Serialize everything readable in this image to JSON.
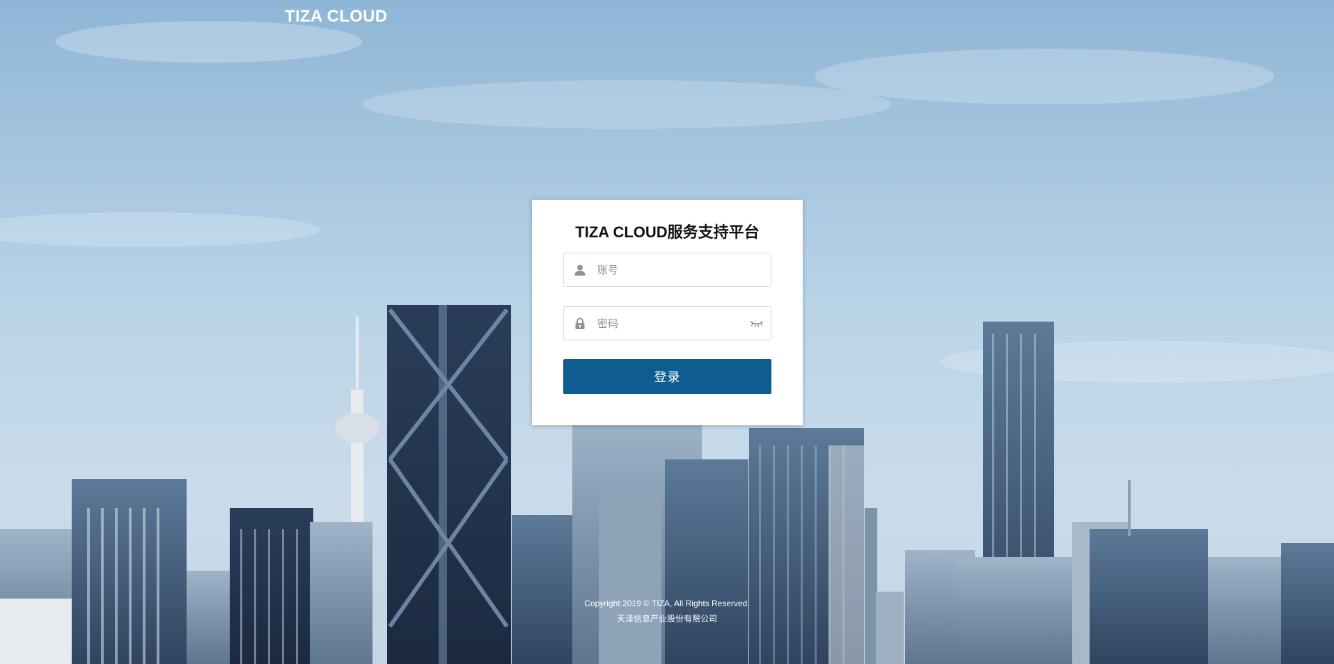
{
  "header": {
    "brand": "TIZA CLOUD"
  },
  "login": {
    "title": "TIZA CLOUD服务支持平台",
    "account_placeholder": "账号",
    "password_placeholder": "密码",
    "submit_label": "登录",
    "account_icon": "user-icon",
    "password_icon": "lock-icon",
    "toggle_icon": "eye-closed-icon"
  },
  "footer": {
    "copyright": "Copyright 2019 © TIZA, All Rights Reserved.",
    "company": "天泽信息产业股份有限公司"
  },
  "colors": {
    "primary_button": "#0f5c91",
    "card_bg": "#ffffff",
    "input_border": "#d5d9de"
  }
}
